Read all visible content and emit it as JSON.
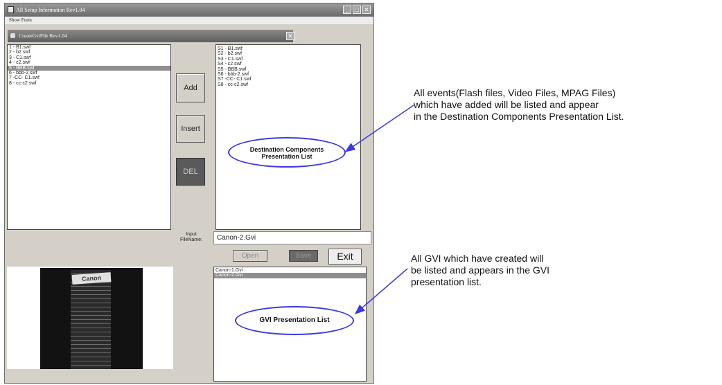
{
  "outer_window": {
    "title": "All Setup Information Rev1.04",
    "menu": "Show Form"
  },
  "inner_window": {
    "title": "CreateGviFile Rev1.04",
    "close_glyph": "✕"
  },
  "source_list": {
    "items": [
      "1 - B1.swf",
      "2 - b2.swf",
      "3 - C1.swf",
      "4 - c2.swf",
      "5 - BBB.swf",
      "6 - bbb-2.swf",
      "7 -CC- C1.swf",
      "8 - cc-c2.swf"
    ],
    "selected_index": 4
  },
  "dest_list": {
    "items": [
      "S1 - B1.swf",
      "S2 - b2.swf",
      "S3 - C1.swf",
      "S4 - c2.swf",
      "S5 - BBB.swf",
      "S6 - bbb-2.swf",
      "S7 -CC- C1.swf",
      "S8 - cc-c2.swf"
    ]
  },
  "buttons": {
    "add": "Add",
    "insert": "Insert",
    "del": "DEL",
    "open": "Open",
    "save": "Save",
    "exit": "Exit"
  },
  "file_input": {
    "label_line1": "Input",
    "label_line2": "FileName:",
    "value": "Canon-2.Gvi"
  },
  "gvi_list": {
    "items": [
      "Canon-1.Gvi",
      "Canon-2.Gvi"
    ],
    "selected_index": 1
  },
  "preview": {
    "sign_text": "Canon"
  },
  "annotations": {
    "dest_ellipse_line1": "Destination Components",
    "dest_ellipse_line2": "Presentation List",
    "gvi_ellipse": "GVI Presentation List",
    "callout1": [
      "All events(Flash files, Video Files, MPAG Files)",
      "which have added will be listed and appear",
      "in the Destination Components Presentation List."
    ],
    "callout2": [
      "All GVI which have created will",
      "be listed and appears in the GVI",
      "presentation list."
    ],
    "arrow_color": "#3a3ae0"
  }
}
